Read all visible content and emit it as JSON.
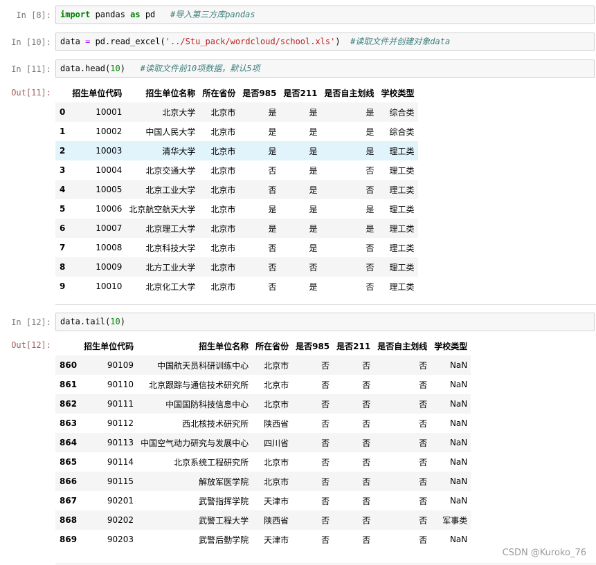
{
  "cell8": {
    "prompt": "In [8]:",
    "kw1": "import",
    "t1": " pandas ",
    "kw2": "as",
    "t2": " pd   ",
    "comment": "#导入第三方库pandas"
  },
  "cell10": {
    "prompt": "In [10]:",
    "t1": "data ",
    "op": "=",
    "t2": " pd.read_excel(",
    "str": "'../Stu_pack/wordcloud/school.xls'",
    "t3": ")  ",
    "comment": "#读取文件并创建对象data"
  },
  "cell11": {
    "prompt": "In [11]:",
    "t1": "data.head(",
    "num": "10",
    "t2": ")   ",
    "comment": "#读取文件前10项数据，默认5项",
    "out_prompt": "Out[11]:"
  },
  "cell12": {
    "prompt": "In [12]:",
    "t1": "data.tail(",
    "num": "10",
    "t2": ")",
    "out_prompt": "Out[12]:"
  },
  "columns": [
    "",
    "招生单位代码",
    "招生单位名称",
    "所在省份",
    "是否985",
    "是否211",
    "是否自主划线",
    "学校类型"
  ],
  "head_rows": [
    [
      "0",
      "10001",
      "北京大学",
      "北京市",
      "是",
      "是",
      "是",
      "综合类"
    ],
    [
      "1",
      "10002",
      "中国人民大学",
      "北京市",
      "是",
      "是",
      "是",
      "综合类"
    ],
    [
      "2",
      "10003",
      "清华大学",
      "北京市",
      "是",
      "是",
      "是",
      "理工类"
    ],
    [
      "3",
      "10004",
      "北京交通大学",
      "北京市",
      "否",
      "是",
      "否",
      "理工类"
    ],
    [
      "4",
      "10005",
      "北京工业大学",
      "北京市",
      "否",
      "是",
      "否",
      "理工类"
    ],
    [
      "5",
      "10006",
      "北京航空航天大学",
      "北京市",
      "是",
      "是",
      "是",
      "理工类"
    ],
    [
      "6",
      "10007",
      "北京理工大学",
      "北京市",
      "是",
      "是",
      "是",
      "理工类"
    ],
    [
      "7",
      "10008",
      "北京科技大学",
      "北京市",
      "否",
      "是",
      "否",
      "理工类"
    ],
    [
      "8",
      "10009",
      "北方工业大学",
      "北京市",
      "否",
      "否",
      "否",
      "理工类"
    ],
    [
      "9",
      "10010",
      "北京化工大学",
      "北京市",
      "否",
      "是",
      "否",
      "理工类"
    ]
  ],
  "tail_rows": [
    [
      "860",
      "90109",
      "中国航天员科研训练中心",
      "北京市",
      "否",
      "否",
      "否",
      "NaN"
    ],
    [
      "861",
      "90110",
      "北京跟踪与通信技术研究所",
      "北京市",
      "否",
      "否",
      "否",
      "NaN"
    ],
    [
      "862",
      "90111",
      "中国国防科技信息中心",
      "北京市",
      "否",
      "否",
      "否",
      "NaN"
    ],
    [
      "863",
      "90112",
      "西北核技术研究所",
      "陕西省",
      "否",
      "否",
      "否",
      "NaN"
    ],
    [
      "864",
      "90113",
      "中国空气动力研究与发展中心",
      "四川省",
      "否",
      "否",
      "否",
      "NaN"
    ],
    [
      "865",
      "90114",
      "北京系统工程研究所",
      "北京市",
      "否",
      "否",
      "否",
      "NaN"
    ],
    [
      "866",
      "90115",
      "解放军医学院",
      "北京市",
      "否",
      "否",
      "否",
      "NaN"
    ],
    [
      "867",
      "90201",
      "武警指挥学院",
      "天津市",
      "否",
      "否",
      "否",
      "NaN"
    ],
    [
      "868",
      "90202",
      "武警工程大学",
      "陕西省",
      "否",
      "否",
      "否",
      "军事类"
    ],
    [
      "869",
      "90203",
      "武警后勤学院",
      "天津市",
      "否",
      "否",
      "否",
      "NaN"
    ]
  ],
  "watermark": "CSDN @Kuroko_76"
}
